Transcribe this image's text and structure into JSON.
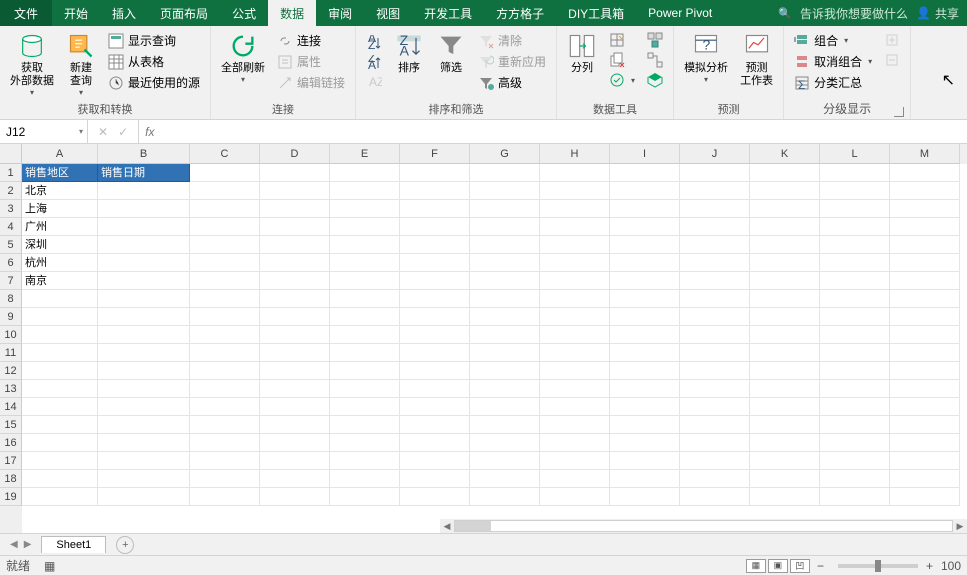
{
  "tabs": {
    "file": "文件",
    "list": [
      "开始",
      "插入",
      "页面布局",
      "公式",
      "数据",
      "审阅",
      "视图",
      "开发工具",
      "方方格子",
      "DIY工具箱",
      "Power Pivot"
    ],
    "activeIndex": 4,
    "tellme": "告诉我你想要做什么",
    "share": "共享"
  },
  "ribbon": {
    "g1": {
      "label": "获取和转换",
      "getExternal": "获取\n外部数据",
      "newQuery": "新建\n查询",
      "showQuery": "显示查询",
      "fromTable": "从表格",
      "recent": "最近使用的源"
    },
    "g2": {
      "label": "连接",
      "refreshAll": "全部刷新",
      "connections": "连接",
      "properties": "属性",
      "editLinks": "编辑链接"
    },
    "g3": {
      "label": "排序和筛选",
      "sortAsc": "A→Z",
      "sortDesc": "Z→A",
      "sort": "排序",
      "filter": "筛选",
      "clear": "清除",
      "reapply": "重新应用",
      "advanced": "高级"
    },
    "g4": {
      "label": "数据工具",
      "textToCol": "分列"
    },
    "g5": {
      "label": "预测",
      "whatif": "模拟分析",
      "forecast": "预测\n工作表"
    },
    "g6": {
      "label": "分级显示",
      "group": "组合",
      "ungroup": "取消组合",
      "subtotal": "分类汇总"
    }
  },
  "formula": {
    "nameBox": "J12",
    "fx": "fx",
    "value": ""
  },
  "columns": [
    "A",
    "B",
    "C",
    "D",
    "E",
    "F",
    "G",
    "H",
    "I",
    "J",
    "K",
    "L",
    "M"
  ],
  "rows": [
    "1",
    "2",
    "3",
    "4",
    "5",
    "6",
    "7",
    "8",
    "9",
    "10",
    "11",
    "12",
    "13",
    "14",
    "15",
    "16",
    "17",
    "18",
    "19"
  ],
  "cells": {
    "A1": "销售地区",
    "B1": "销售日期",
    "A2": "北京",
    "A3": "上海",
    "A4": "广州",
    "A5": "深圳",
    "A6": "杭州",
    "A7": "南京"
  },
  "sheet": {
    "name": "Sheet1",
    "ready": "就绪",
    "zoom": "100"
  }
}
